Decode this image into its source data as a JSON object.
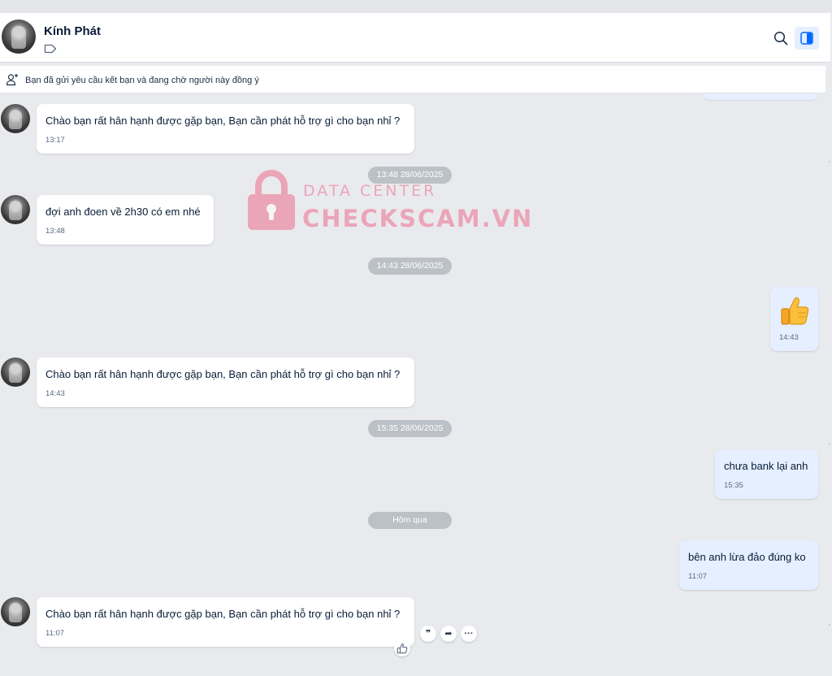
{
  "contact": {
    "name": "Kính Phát"
  },
  "friend_request": {
    "text": "Bạn đã gửi yêu cầu kết bạn và đang chờ người này đồng ý"
  },
  "watermark": {
    "line1": "DATA CENTER",
    "line2": "CHECKSCAM.VN",
    "color": "#ee6e8d"
  },
  "dividers": [
    "13:48 28/06/2025",
    "14:43 28/06/2025",
    "15:35 28/06/2025",
    "Hôm qua"
  ],
  "messages": [
    {
      "direction": "in",
      "text": "Chào bạn rất hân hạnh được gặp bạn, Bạn cần phát hỗ trợ gì cho bạn nhỉ ?",
      "time": "13:17"
    },
    {
      "direction": "in",
      "text": "đợi anh đoen về 2h30 có em nhé",
      "time": "13:48"
    },
    {
      "direction": "out",
      "emoji": "thumbs-up",
      "time": "14:43"
    },
    {
      "direction": "in",
      "text": "Chào bạn rất hân hạnh được gặp bạn, Bạn cần phát hỗ trợ gì cho bạn nhỉ ?",
      "time": "14:43"
    },
    {
      "direction": "out",
      "text": "chưa bank lại anh",
      "time": "15:35"
    },
    {
      "direction": "out",
      "text": "bên anh lừa đảo đúng ko",
      "time": "11:07"
    },
    {
      "direction": "in",
      "text": "Chào bạn rất hân hạnh được gặp bạn, Bạn cần phát hỗ trợ gì cho bạn nhỉ ?",
      "time": "11:07"
    }
  ],
  "message_actions": {
    "quote": "❞",
    "forward": "➦",
    "more": "···"
  },
  "colors": {
    "outgoing_bubble": "#e5efff",
    "incoming_bubble": "#ffffff",
    "accent": "#0068ff",
    "background": "#e9eaed"
  },
  "icons": [
    "tag-icon",
    "search-icon",
    "side-panel-icon",
    "add-friend-icon",
    "thumbs-up-icon",
    "like-icon"
  ]
}
